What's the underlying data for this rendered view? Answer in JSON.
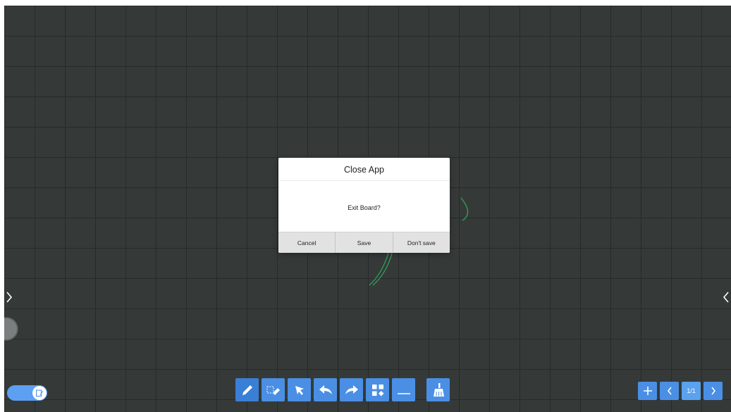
{
  "dialog": {
    "title": "Close App",
    "message": "Exit Board?",
    "buttons": {
      "cancel": "Cancel",
      "save": "Save",
      "dont_save": "Don't save"
    }
  },
  "toolbar": {
    "tools": [
      "pen-icon",
      "eraser-icon",
      "select-arrow-icon",
      "undo-icon",
      "redo-icon",
      "apps-grid-icon",
      "line-width-icon",
      "clear-broom-icon"
    ]
  },
  "page_nav": {
    "indicator": "1/1"
  },
  "colors": {
    "board": "#353a39",
    "grid": "#262a2a",
    "accent": "#4a8fe4",
    "stroke": "#2fa55a"
  }
}
